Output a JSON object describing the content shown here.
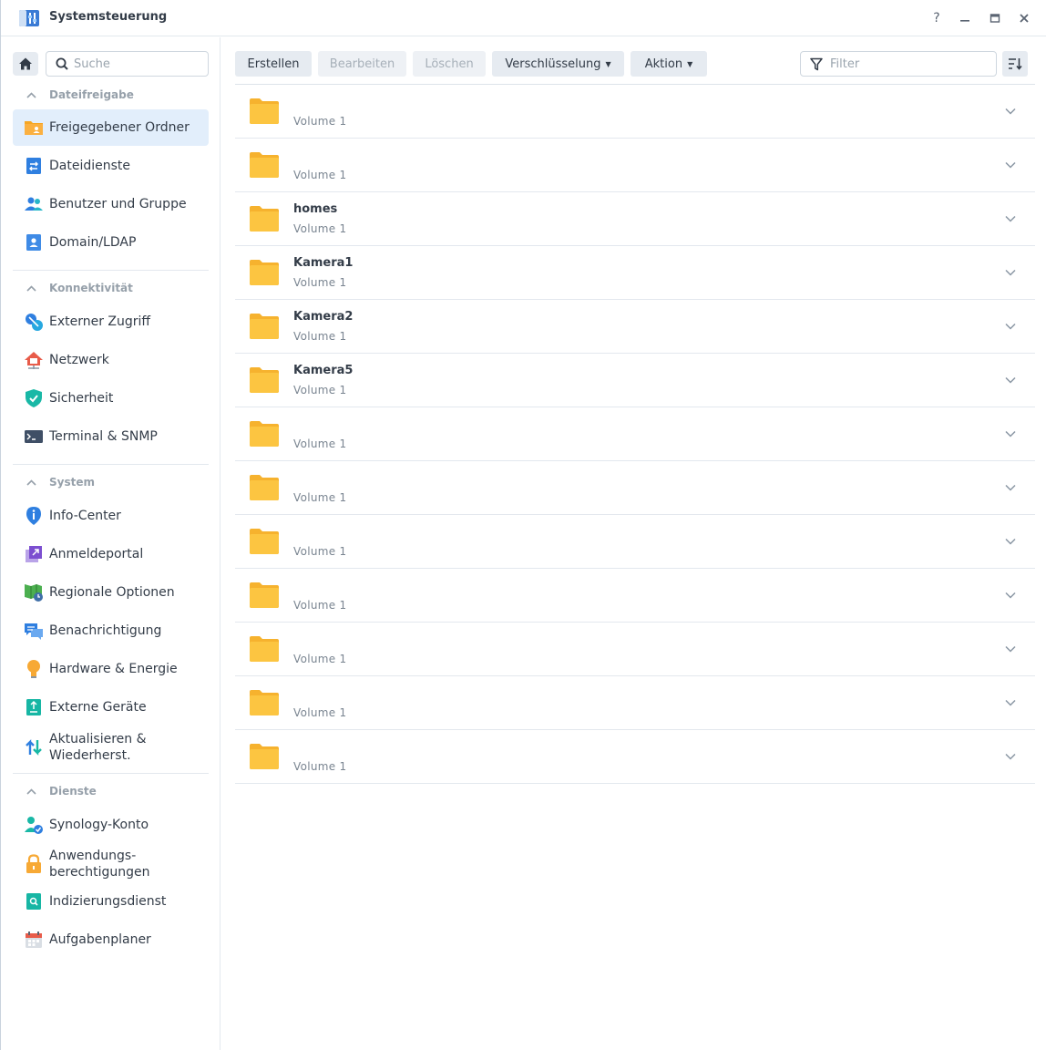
{
  "window": {
    "title": "Systemsteuerung",
    "help": "?",
    "minimize": "—",
    "maximize": "▭",
    "close": "✕"
  },
  "search": {
    "placeholder": "Suche"
  },
  "sections": [
    {
      "label": "Dateifreigabe",
      "items": [
        {
          "label": "Freigegebener Ordner",
          "icon": "folder-share-icon",
          "active": true
        },
        {
          "label": "Dateidienste",
          "icon": "file-services-icon"
        },
        {
          "label": "Benutzer und Gruppe",
          "icon": "users-icon"
        },
        {
          "label": "Domain/LDAP",
          "icon": "domain-icon"
        }
      ]
    },
    {
      "label": "Konnektivität",
      "items": [
        {
          "label": "Externer Zugriff",
          "icon": "external-access-icon"
        },
        {
          "label": "Netzwerk",
          "icon": "network-icon"
        },
        {
          "label": "Sicherheit",
          "icon": "shield-icon"
        },
        {
          "label": "Terminal & SNMP",
          "icon": "terminal-icon"
        }
      ]
    },
    {
      "label": "System",
      "items": [
        {
          "label": "Info-Center",
          "icon": "info-icon"
        },
        {
          "label": "Anmeldeportal",
          "icon": "login-portal-icon"
        },
        {
          "label": "Regionale Optionen",
          "icon": "regional-icon"
        },
        {
          "label": "Benachrichtigung",
          "icon": "notification-icon"
        },
        {
          "label": "Hardware & Energie",
          "icon": "bulb-icon"
        },
        {
          "label": "Externe Geräte",
          "icon": "external-devices-icon"
        },
        {
          "label": "Aktualisieren & Wiederherst.",
          "icon": "update-icon"
        }
      ]
    },
    {
      "label": "Dienste",
      "items": [
        {
          "label": "Synology-Konto",
          "icon": "account-icon"
        },
        {
          "label": "Anwendungs-berechtigungen",
          "icon": "lock-icon"
        },
        {
          "label": "Indizierungsdienst",
          "icon": "index-icon"
        },
        {
          "label": "Aufgabenplaner",
          "icon": "calendar-icon"
        }
      ]
    }
  ],
  "toolbar": {
    "create": "Erstellen",
    "edit": "Bearbeiten",
    "delete": "Löschen",
    "encryption": "Verschlüsselung",
    "action": "Aktion",
    "filter_placeholder": "Filter"
  },
  "folders": [
    {
      "name": "",
      "volume": "Volume 1"
    },
    {
      "name": "",
      "volume": "Volume 1"
    },
    {
      "name": "homes",
      "volume": "Volume 1"
    },
    {
      "name": "Kamera1",
      "volume": "Volume 1"
    },
    {
      "name": "Kamera2",
      "volume": "Volume 1"
    },
    {
      "name": "Kamera5",
      "volume": "Volume 1"
    },
    {
      "name": "",
      "volume": "Volume 1"
    },
    {
      "name": "",
      "volume": "Volume 1"
    },
    {
      "name": "",
      "volume": "Volume 1"
    },
    {
      "name": "",
      "volume": "Volume 1"
    },
    {
      "name": "",
      "volume": "Volume 1"
    },
    {
      "name": "",
      "volume": "Volume 1"
    },
    {
      "name": "",
      "volume": "Volume 1"
    }
  ],
  "colors": {
    "accent": "#e2eefb",
    "folder": "#fcc541",
    "folder_dark": "#f6b22e"
  }
}
